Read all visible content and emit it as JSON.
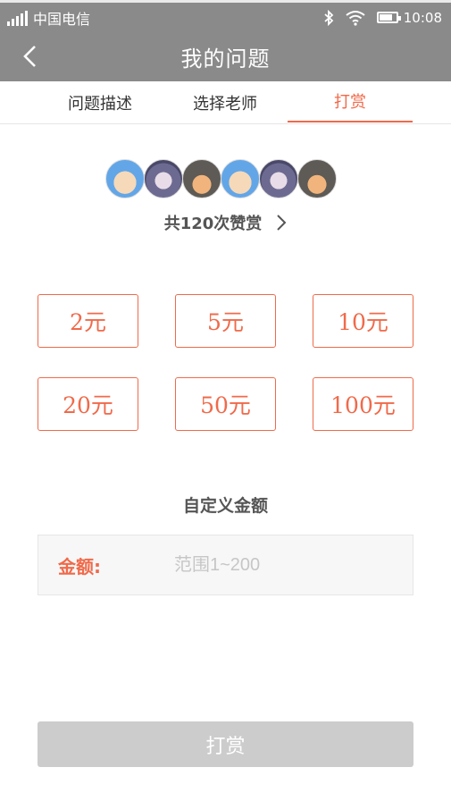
{
  "status_bar": {
    "carrier": "中国电信",
    "time": "10:08",
    "icons": [
      "signal-icon",
      "bluetooth-icon",
      "wifi-icon",
      "battery-icon"
    ]
  },
  "header": {
    "title": "我的问题",
    "back_icon": "chevron-left-icon"
  },
  "tabs": [
    {
      "label": "问题描述",
      "active": false
    },
    {
      "label": "选择老师",
      "active": false
    },
    {
      "label": "打赏",
      "active": true
    }
  ],
  "rewards": {
    "avatars": [
      "boy-avatar",
      "girl-avatar",
      "soldier-avatar",
      "boy-avatar",
      "girl-avatar",
      "soldier-avatar"
    ],
    "count_text": "共120次赞赏",
    "arrow_icon": "chevron-right-icon"
  },
  "amounts": [
    "2元",
    "5元",
    "10元",
    "20元",
    "50元",
    "100元"
  ],
  "custom": {
    "title": "自定义金额",
    "label": "金额:",
    "placeholder": "范围1~200",
    "value": ""
  },
  "submit_label": "打赏",
  "colors": {
    "accent": "#f06a4a",
    "header_bg": "#8a8a8a",
    "disabled_button": "#cccccc"
  }
}
